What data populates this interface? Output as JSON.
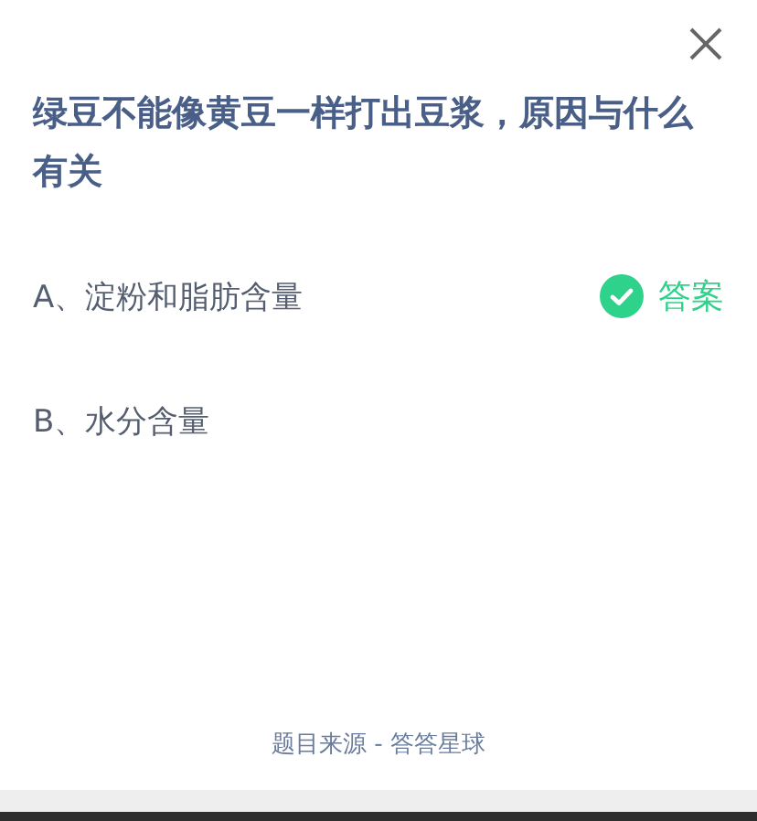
{
  "question": "绿豆不能像黄豆一样打出豆浆，原因与什么有关",
  "options": [
    {
      "label": "A、淀粉和脂肪含量",
      "correct": true,
      "tag": "答案"
    },
    {
      "label": "B、水分含量",
      "correct": false
    }
  ],
  "footer": "题目来源 - 答答星球"
}
